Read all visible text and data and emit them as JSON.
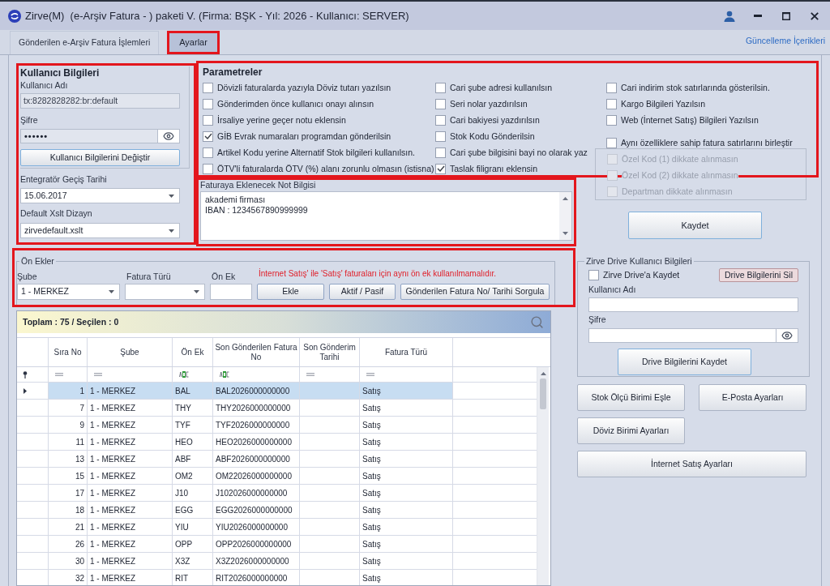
{
  "window": {
    "title": "Zirve(M)  (e-Arşiv Fatura - ) paketi V. (Firma: BŞK - Yıl: 2026 - Kullanıcı: SERVER)"
  },
  "tabs": [
    {
      "label": "Gönderilen e-Arşiv Fatura İşlemleri",
      "selected": false,
      "highlighted": false
    },
    {
      "label": "Ayarlar",
      "selected": true,
      "highlighted": true
    }
  ],
  "update_link": "Güncelleme İçerikleri",
  "user_info": {
    "title": "Kullanıcı Bilgileri",
    "highlighted": true,
    "username_label": "Kullanıcı Adı",
    "username": "tx:8282828282:br:default",
    "password_label": "Şifre",
    "password": "••••••",
    "change_button": "Kullanıcı Bilgilerini Değiştir",
    "date_label": "Entegratör Geçiş Tarihi",
    "date": "15.06.2017",
    "xslt_label": "Default Xslt Dizayn",
    "xslt": "zirvedefault.xslt"
  },
  "parameters": {
    "title": "Parametreler",
    "highlighted": true,
    "columns": [
      {
        "items": [
          {
            "label": "Dövizli faturalarda yazıyla Döviz tutarı yazılsın",
            "checked": false
          },
          {
            "label": "Gönderimden önce kullanıcı onayı alınsın",
            "checked": false
          },
          {
            "label": "İrsaliye yerine geçer notu eklensin",
            "checked": false
          },
          {
            "label": "GİB Evrak numaraları programdan gönderilsin",
            "checked": true
          },
          {
            "label": "Artikel Kodu yerine Alternatif Stok bilgileri kullanılsın.",
            "checked": false
          },
          {
            "label": "ÖTV'li faturalarda ÖTV (%) alanı zorunlu olmasın (istisna)",
            "checked": false
          }
        ]
      },
      {
        "items": [
          {
            "label": "Cari şube adresi kullanılsın",
            "checked": false
          },
          {
            "label": "Seri nolar yazdırılsın",
            "checked": false
          },
          {
            "label": "Cari bakiyesi yazdırılsın",
            "checked": false
          },
          {
            "label": "Stok Kodu Gönderilsin",
            "checked": false
          },
          {
            "label": "Cari şube bilgisini bayi no olarak yaz",
            "checked": false
          },
          {
            "label": "Taslak filigranı eklensin",
            "checked": true
          }
        ]
      },
      {
        "items": [
          {
            "label": "Cari indirim stok satırlarında gösterilsin.",
            "checked": false
          },
          {
            "label": "Kargo Bilgileri Yazılsın",
            "checked": false
          },
          {
            "label": "Web (İnternet Satış) Bilgileri Yazılsın",
            "checked": false
          },
          {
            "label": "Aynı özelliklere sahip fatura satırlarını birleştir",
            "checked": false,
            "children": [
              {
                "label": "Özel Kod (1) dikkate alınmasın",
                "checked": false,
                "disabled": true
              },
              {
                "label": "Özel Kod (2) dikkate alınmasın",
                "checked": false,
                "disabled": true
              },
              {
                "label": "Departman dikkate alınmasın",
                "checked": false,
                "disabled": true
              }
            ]
          }
        ]
      }
    ]
  },
  "note": {
    "label": "Faturaya Eklenecek Not Bilgisi",
    "highlighted": true,
    "lines": [
      "akademi firması",
      "IBAN : 1234567890999999"
    ]
  },
  "save_button": "Kaydet",
  "prefixes": {
    "title": "Ön Ekler",
    "highlighted": true,
    "branch": {
      "label": "Şube",
      "value": "1 - MERKEZ"
    },
    "invoice_type": {
      "label": "Fatura Türü"
    },
    "prefix": {
      "label": "Ön Ek"
    },
    "warning": "İnternet Satış' ile 'Satış' faturaları için aynı ön ek kullanılmamalıdır.",
    "buttons": [
      "Ekle",
      "Aktif / Pasif",
      "Gönderilen Fatura No/ Tarihi Sorgula"
    ]
  },
  "grid": {
    "summary": "Toplam : 75 / Seçilen : 0",
    "columns": [
      {
        "label": "Sıra No",
        "kind": "equals"
      },
      {
        "label": "Şube",
        "kind": "equals"
      },
      {
        "label": "Ön Ek",
        "kind": "text"
      },
      {
        "label": "Son Gönderilen Fatura No",
        "kind": "text"
      },
      {
        "label": "Son Gönderim Tarihi",
        "kind": "equals"
      },
      {
        "label": "Fatura Türü",
        "kind": "equals"
      }
    ],
    "rows": [
      {
        "no": "1",
        "branch": "1 - MERKEZ",
        "prefix": "BAL",
        "last_invoice_no": "BAL2026000000000",
        "invoice_type": "Satış",
        "selected": true
      },
      {
        "no": "7",
        "branch": "1 - MERKEZ",
        "prefix": "THY",
        "last_invoice_no": "THY2026000000000",
        "invoice_type": "Satış",
        "selected": false
      },
      {
        "no": "9",
        "branch": "1 - MERKEZ",
        "prefix": "TYF",
        "last_invoice_no": "TYF2026000000000",
        "invoice_type": "Satış",
        "selected": false
      },
      {
        "no": "11",
        "branch": "1 - MERKEZ",
        "prefix": "HEO",
        "last_invoice_no": "HEO2026000000000",
        "invoice_type": "Satış",
        "selected": false
      },
      {
        "no": "13",
        "branch": "1 - MERKEZ",
        "prefix": "ABF",
        "last_invoice_no": "ABF2026000000000",
        "invoice_type": "Satış",
        "selected": false
      },
      {
        "no": "15",
        "branch": "1 - MERKEZ",
        "prefix": "OM2",
        "last_invoice_no": "OM22026000000000",
        "invoice_type": "Satış",
        "selected": false
      },
      {
        "no": "17",
        "branch": "1 - MERKEZ",
        "prefix": "J10",
        "last_invoice_no": "J102026000000000",
        "invoice_type": "Satış",
        "selected": false
      },
      {
        "no": "18",
        "branch": "1 - MERKEZ",
        "prefix": "EGG",
        "last_invoice_no": "EGG2026000000000",
        "invoice_type": "Satış",
        "selected": false
      },
      {
        "no": "21",
        "branch": "1 - MERKEZ",
        "prefix": "YIU",
        "last_invoice_no": "YIU2026000000000",
        "invoice_type": "Satış",
        "selected": false
      },
      {
        "no": "26",
        "branch": "1 - MERKEZ",
        "prefix": "OPP",
        "last_invoice_no": "OPP2026000000000",
        "invoice_type": "Satış",
        "selected": false
      },
      {
        "no": "30",
        "branch": "1 - MERKEZ",
        "prefix": "X3Z",
        "last_invoice_no": "X3Z2026000000000",
        "invoice_type": "Satış",
        "selected": false
      },
      {
        "no": "32",
        "branch": "1 - MERKEZ",
        "prefix": "RIT",
        "last_invoice_no": "RIT2026000000000",
        "invoice_type": "Satış",
        "selected": false
      }
    ]
  },
  "drive": {
    "title": "Zirve Drive Kullanıcı Bilgileri",
    "save_to_drive": {
      "label": "Zirve Drive'a Kaydet",
      "checked": false
    },
    "delete_button": "Drive Bilgilerini Sil",
    "username_label": "Kullanıcı Adı",
    "password_label": "Şifre",
    "save_button": "Drive Bilgilerini Kaydet"
  },
  "actions": [
    "Stok Ölçü Birimi Eşle",
    "E-Posta Ayarları",
    "Döviz Birimi Ayarları",
    "İnternet Satış Ayarları"
  ]
}
